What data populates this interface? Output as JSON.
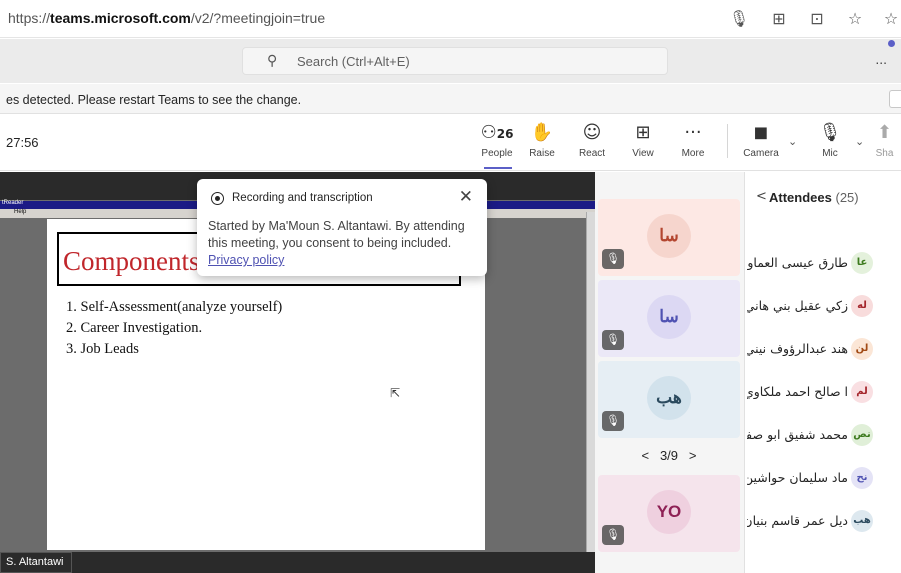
{
  "browser": {
    "url_prefix": "https://",
    "url_domain": "teams.microsoft.com",
    "url_path": "/v2/?meetingjoin=true"
  },
  "topbar": {
    "search_placeholder": "Search (Ctrl+Alt+E)",
    "more_label": "..."
  },
  "notice": {
    "text": "es detected. Please restart Teams to see the change."
  },
  "meeting": {
    "timer": "27:56",
    "people_count": "26",
    "toolbar": {
      "people": "People",
      "raise": "Raise",
      "react": "React",
      "view": "View",
      "more": "More",
      "more_glyph": "···",
      "camera": "Camera",
      "mic": "Mic",
      "share": "Sha"
    }
  },
  "slide": {
    "title": "Components",
    "items": [
      "1.   Self-Assessment(analyze yourself)",
      "2.   Career Investigation.",
      "3.   Job Leads"
    ],
    "app_title": "tReader",
    "menu": "Help"
  },
  "recording": {
    "heading": "Recording and transcription",
    "body": "Started by Ma'Moun S. Altantawi. By attending this meeting, you consent to being included.",
    "link": "Privacy policy"
  },
  "presenter_label": "S. Altantawi",
  "gallery": {
    "tiles": [
      {
        "initials": "سا",
        "bg": "#fde8e4",
        "av_bg": "#f6d5cd",
        "color": "#b3452f"
      },
      {
        "initials": "سا",
        "bg": "#ebe8f7",
        "av_bg": "#dcd8f3",
        "color": "#4f52b2"
      },
      {
        "initials": "هب",
        "bg": "#e6eef4",
        "av_bg": "#d2e2ec",
        "color": "#2b4a5e"
      },
      {
        "initials": "YO",
        "bg": "#f5e4ec",
        "av_bg": "#efd0df",
        "color": "#8e2155"
      }
    ],
    "pager": "3/9"
  },
  "attendees": {
    "title": "Attendees",
    "count": "(25)",
    "list": [
      {
        "name": "طارق عيسى العماوى",
        "initials": "عا",
        "bg": "#e4f1dc",
        "color": "#3d7a1e"
      },
      {
        "name": "زكي عقيل بني هاني",
        "initials": "له",
        "bg": "#f8dcdc",
        "color": "#a4262c"
      },
      {
        "name": "هند عبدالرؤوف نيني",
        "initials": "لن",
        "bg": "#fbe6d6",
        "color": "#a24b16"
      },
      {
        "name": "ا صالح احمد ملكاوي",
        "initials": "لم",
        "bg": "#f9dfe2",
        "color": "#a4262c"
      },
      {
        "name": "محمد شفيق ابو صفا",
        "initials": "نص",
        "bg": "#e0efd8",
        "color": "#3d7a1e"
      },
      {
        "name": "ماد سليمان حواشين",
        "initials": "نح",
        "bg": "#e4e3f6",
        "color": "#4f52b2"
      },
      {
        "name": "ديل عمر قاسم بنيان",
        "initials": "هب",
        "bg": "#dde8ef",
        "color": "#2b4a5e"
      }
    ]
  }
}
